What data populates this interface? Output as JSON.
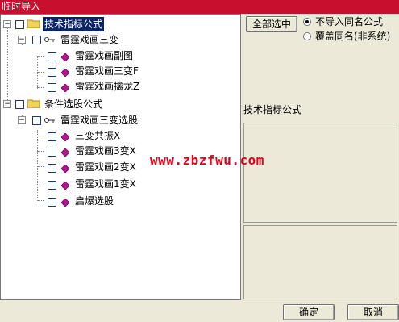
{
  "window": {
    "title": "临时导入"
  },
  "tree": {
    "groups": [
      {
        "label": "技术指标公式",
        "subgroup": {
          "label": "雷霆戏画三变",
          "items": [
            "雷霆戏画副图",
            "雷霆戏画三变F",
            "雷霆戏画擒龙Z"
          ]
        }
      },
      {
        "label": "条件选股公式",
        "subgroup": {
          "label": "雷霆戏画三变选股",
          "items": [
            "三变共振X",
            "雷霆戏画3变X",
            "雷霆戏画2变X",
            "雷霆戏画1变X",
            "启爆选股"
          ]
        }
      }
    ]
  },
  "options": {
    "select_all_label": "全部选中",
    "radio_skip_label": "不导入同名公式",
    "radio_overwrite_label": "覆盖同名(非系统)",
    "selected": "skip"
  },
  "info": {
    "label": "技术指标公式"
  },
  "watermark": "www.zbzfwu.com",
  "footer": {
    "ok_label": "确定",
    "cancel_label": "取消"
  },
  "colors": {
    "title_bg": "#c8102e",
    "selection_bg": "#0a246a",
    "formula_icon": "#b0188e",
    "folder_icon": "#f3d25a",
    "watermark": "#e4001b"
  }
}
